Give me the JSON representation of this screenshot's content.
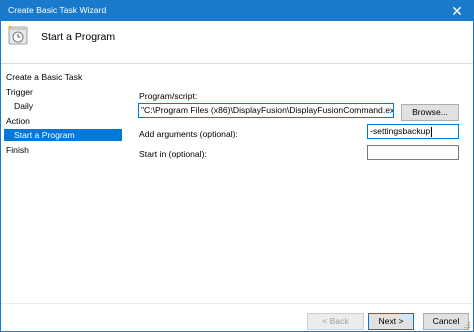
{
  "window": {
    "title": "Create Basic Task Wizard"
  },
  "header": {
    "heading": "Start a Program"
  },
  "steps": [
    {
      "label": "Create a Basic Task",
      "active": false
    },
    {
      "label": "Trigger",
      "active": false
    },
    {
      "label": "Daily",
      "active": false
    },
    {
      "label": "Action",
      "active": false
    },
    {
      "label": "Start a Program",
      "active": true
    },
    {
      "label": "Finish",
      "active": false
    }
  ],
  "form": {
    "program_label": "Program/script:",
    "program_value": "\"C:\\Program Files (x86)\\DisplayFusion\\DisplayFusionCommand.exe\"",
    "browse_label": "Browse...",
    "args_label": "Add arguments (optional):",
    "args_value": "-settingsbackup",
    "startin_label": "Start in (optional):",
    "startin_value": ""
  },
  "buttons": {
    "back": "< Back",
    "next": "Next >",
    "cancel": "Cancel"
  },
  "colors": {
    "accent": "#1979ca",
    "selection": "#0078d7"
  }
}
